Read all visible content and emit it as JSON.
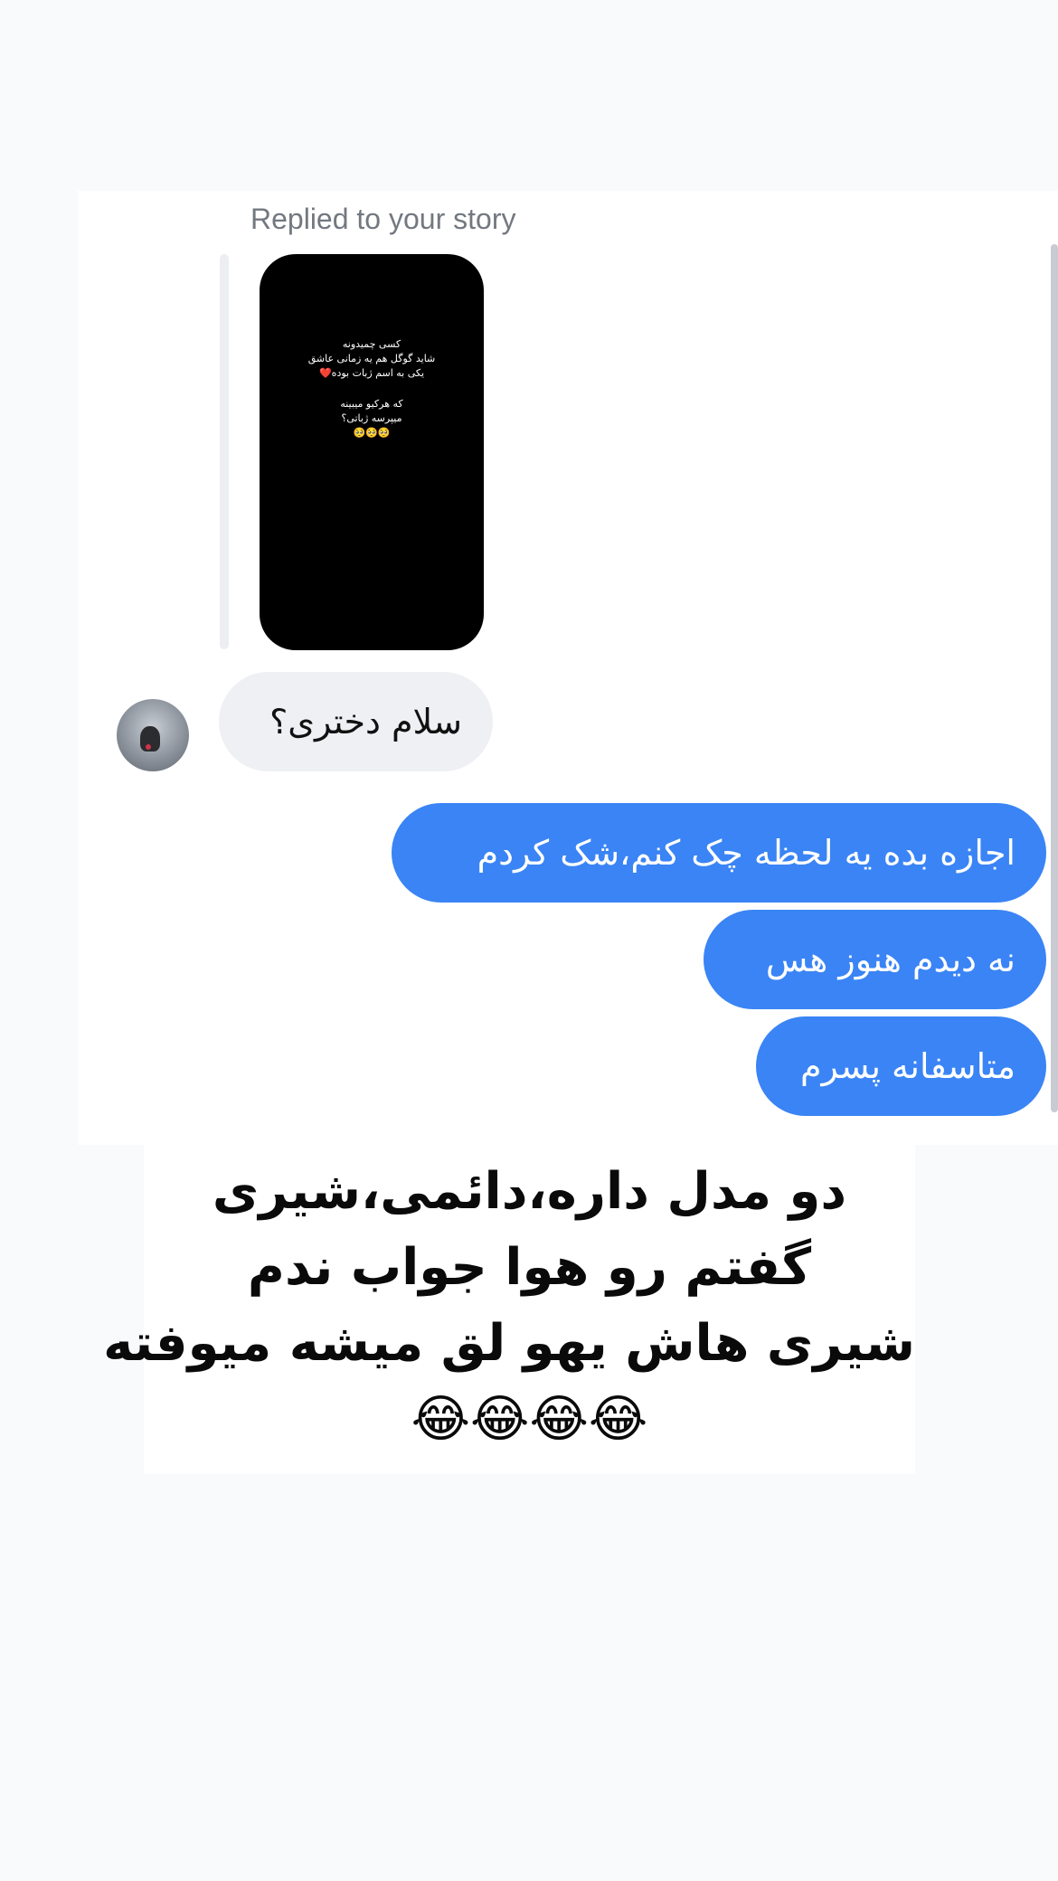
{
  "chat": {
    "reply_label": "Replied to your story",
    "story_text": [
      "کسی چمیدونه",
      "شاید گوگل هم یه زمانی عاشق",
      "یکی به اسم ژبات بوده❤️",
      "",
      "که هرکیو میبینه",
      "میپرسه ژباتی؟",
      "🥺🥺🥺"
    ],
    "incoming_message": "سلام دختری؟",
    "outgoing_messages": [
      "اجازه بده یه لحظه چک کنم،شک کردم",
      "نه دیدم هنوز هس",
      "متاسفانه پسرم"
    ],
    "colors": {
      "outgoing_bubble": "#3a84f5",
      "incoming_bubble": "#eff0f4"
    }
  },
  "caption": {
    "lines": [
      "دو مدل داره،دائمی،شیری",
      "گفتم رو هوا جواب ندم",
      "شیری هاش یهو لق میشه میوفته",
      "😂😂😂😂"
    ]
  }
}
